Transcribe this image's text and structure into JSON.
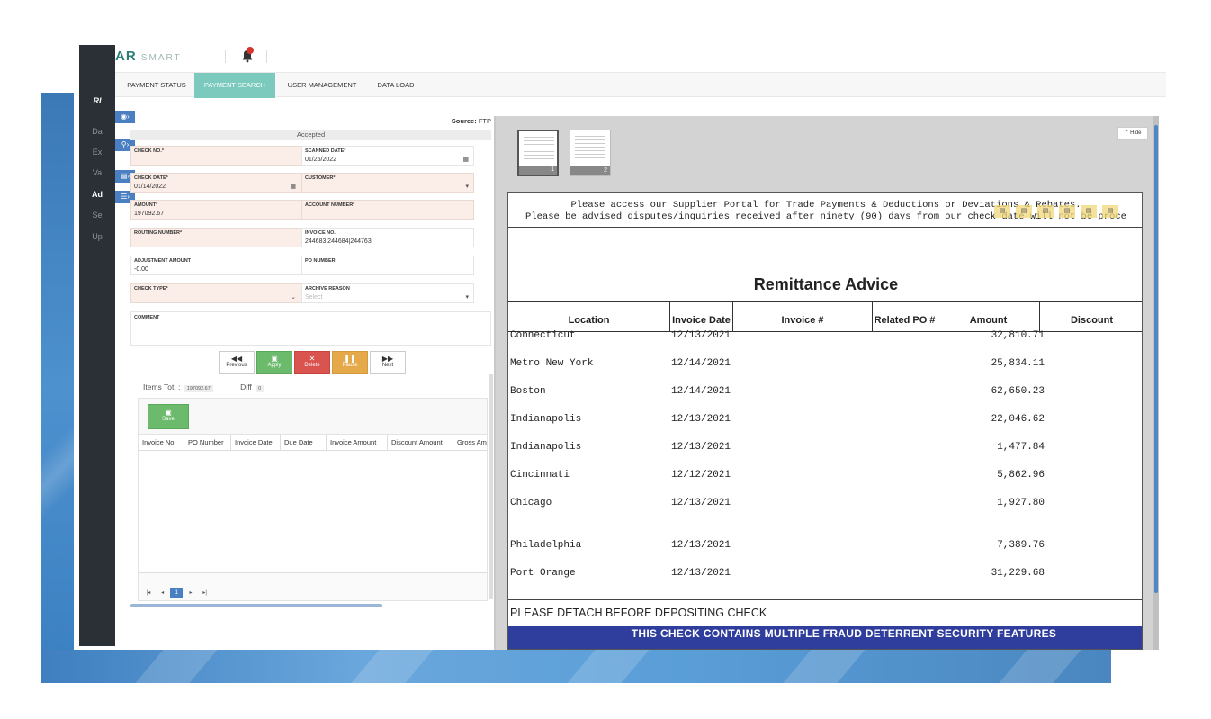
{
  "app": {
    "brand_primary": "AR",
    "brand_secondary": "SMART",
    "notification_count": "2"
  },
  "leftnav": {
    "logo": "RI",
    "items": [
      {
        "label": "Da"
      },
      {
        "label": "Ex"
      },
      {
        "label": "Va"
      },
      {
        "label": "Ad",
        "active": true
      },
      {
        "label": "Se"
      },
      {
        "label": "Up"
      }
    ]
  },
  "tabs": [
    {
      "label": "PAYMENT STATUS"
    },
    {
      "label": "PAYMENT SEARCH",
      "active": true
    },
    {
      "label": "USER MANAGEMENT"
    },
    {
      "label": "DATA LOAD"
    }
  ],
  "form": {
    "source_label": "Source:",
    "source_value": "FTP",
    "status": "Accepted",
    "check_no": {
      "label": "CHECK NO.*",
      "value": ""
    },
    "scanned_date": {
      "label": "SCANNED DATE*",
      "value": "01/25/2022"
    },
    "check_date": {
      "label": "CHECK DATE*",
      "value": "01/14/2022"
    },
    "customer": {
      "label": "CUSTOMER*",
      "value": ""
    },
    "amount": {
      "label": "AMOUNT*",
      "value": "197092.67"
    },
    "account_number": {
      "label": "ACCOUNT NUMBER*",
      "value": ""
    },
    "routing_number": {
      "label": "ROUTING NUMBER*",
      "value": ""
    },
    "invoice_no": {
      "label": "INVOICE NO.",
      "value": "244683|244684|244763|"
    },
    "adjustment_amount": {
      "label": "ADJUSTMENT AMOUNT",
      "value": "-0.00"
    },
    "po_number": {
      "label": "PO NUMBER",
      "value": ""
    },
    "check_type": {
      "label": "CHECK TYPE*",
      "value": ""
    },
    "archive_reason": {
      "label": "ARCHIVE REASON",
      "placeholder": "Select"
    },
    "comment": {
      "label": "COMMENT"
    }
  },
  "actions": {
    "previous": "Previous",
    "apply": "Apply",
    "delete": "Delete",
    "pause": "Pause",
    "next": "Next"
  },
  "totals": {
    "items_tot_label": "Items Tot. :",
    "items_tot_value": "197092.67",
    "diff_label": "Diff",
    "diff_value": "0"
  },
  "items_grid": {
    "save_label": "Save",
    "columns": [
      "Invoice No.",
      "PO Number",
      "Invoice Date",
      "Due Date",
      "Invoice Amount",
      "Discount Amount",
      "Gross Am"
    ],
    "current_page": "1"
  },
  "viewer": {
    "thumbnails": [
      {
        "page": "1"
      },
      {
        "page": "2"
      }
    ],
    "hide_label": "Hide",
    "notice_line1": "Please access our Supplier Portal for Trade Payments & Deductions or Deviations & Rebates.",
    "notice_line2": "Please be advised disputes/inquiries received after ninety (90) days from our check date will not be proce",
    "doc_title": "Remittance Advice",
    "columns": [
      "Location",
      "Invoice Date",
      "Invoice #",
      "Related PO #",
      "Amount",
      "Discount"
    ],
    "rows": [
      {
        "location": "Connecticut",
        "date": "12/13/2021",
        "amount": "32,810.71"
      },
      {
        "location": "Metro New York",
        "date": "12/14/2021",
        "amount": "25,834.11"
      },
      {
        "location": "Boston",
        "date": "12/14/2021",
        "amount": "62,650.23"
      },
      {
        "location": "Indianapolis",
        "date": "12/13/2021",
        "amount": "22,046.62"
      },
      {
        "location": "Indianapolis",
        "date": "12/13/2021",
        "amount": "1,477.84"
      },
      {
        "location": "Cincinnati",
        "date": "12/12/2021",
        "amount": "5,862.96"
      },
      {
        "location": "Chicago",
        "date": "12/13/2021",
        "amount": "1,927.80"
      },
      {
        "location": "Philadelphia",
        "date": "12/13/2021",
        "amount": "7,389.76"
      },
      {
        "location": "Port Orange",
        "date": "12/13/2021",
        "amount": "31,229.68"
      }
    ],
    "detach_text": "PLEASE DETACH BEFORE DEPOSITING CHECK",
    "security_text": "THIS CHECK CONTAINS MULTIPLE FRAUD DETERRENT SECURITY FEATURES"
  },
  "colors": {
    "accent_tab": "#7ccabd",
    "nav_bg": "#2b2f36",
    "apply": "#6cba6c",
    "delete": "#d9534f",
    "pause": "#e6a94a",
    "side_button": "#4a7fc2"
  }
}
